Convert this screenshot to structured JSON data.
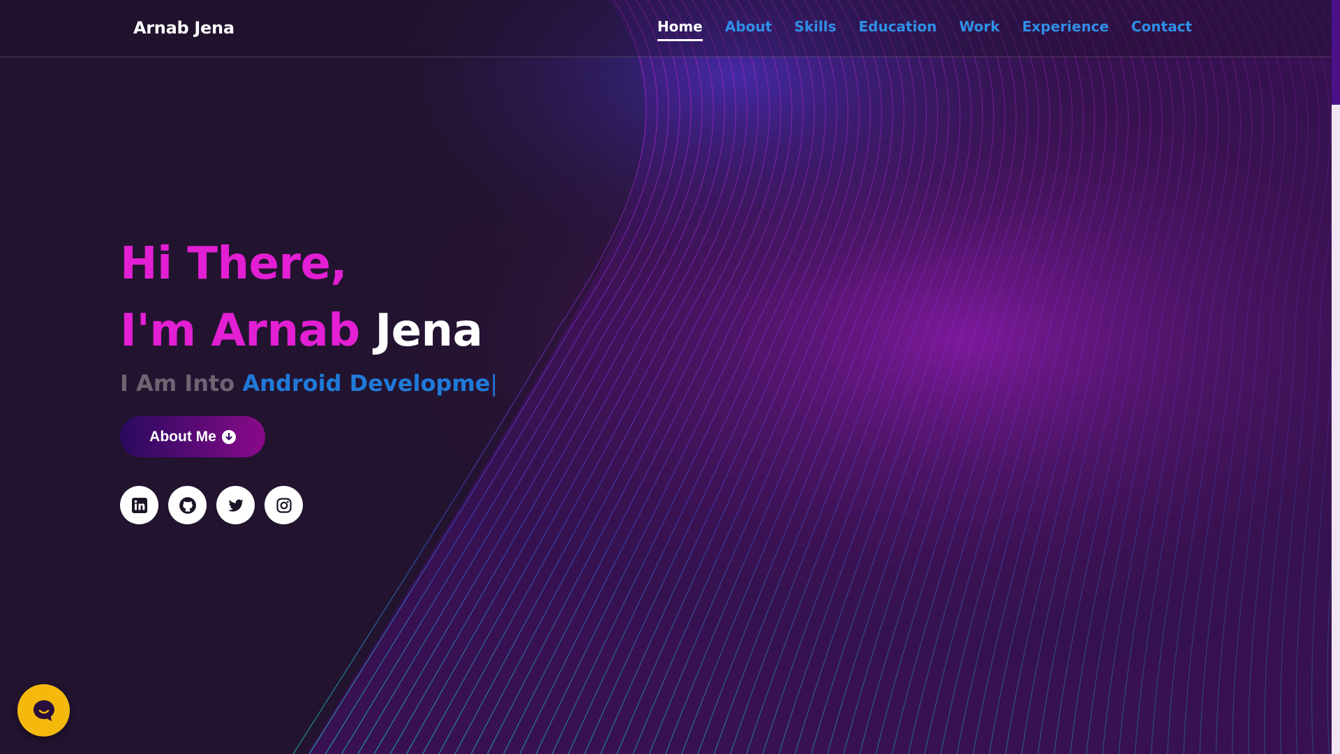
{
  "brand": {
    "name": "Arnab Jena"
  },
  "nav": {
    "items": [
      {
        "label": "Home",
        "active": true
      },
      {
        "label": "About"
      },
      {
        "label": "Skills"
      },
      {
        "label": "Education"
      },
      {
        "label": "Work"
      },
      {
        "label": "Experience"
      },
      {
        "label": "Contact"
      }
    ]
  },
  "hero": {
    "greeting": "Hi There,",
    "intro_prefix": "I'm Arnab",
    "intro_name": "Jena",
    "typing_prefix": "I Am Into",
    "typing_text": "Android Developme",
    "caret": "|",
    "cta_label": "About Me",
    "cta_icon": "arrow-circle-down-icon"
  },
  "socials": [
    {
      "name": "linkedin-icon"
    },
    {
      "name": "github-icon"
    },
    {
      "name": "twitter-icon"
    },
    {
      "name": "instagram-icon"
    }
  ],
  "colors": {
    "background": "#22132f",
    "accent_pink": "#e21fd3",
    "accent_blue": "#2f8fe6",
    "chat_button": "#f5b90e"
  }
}
